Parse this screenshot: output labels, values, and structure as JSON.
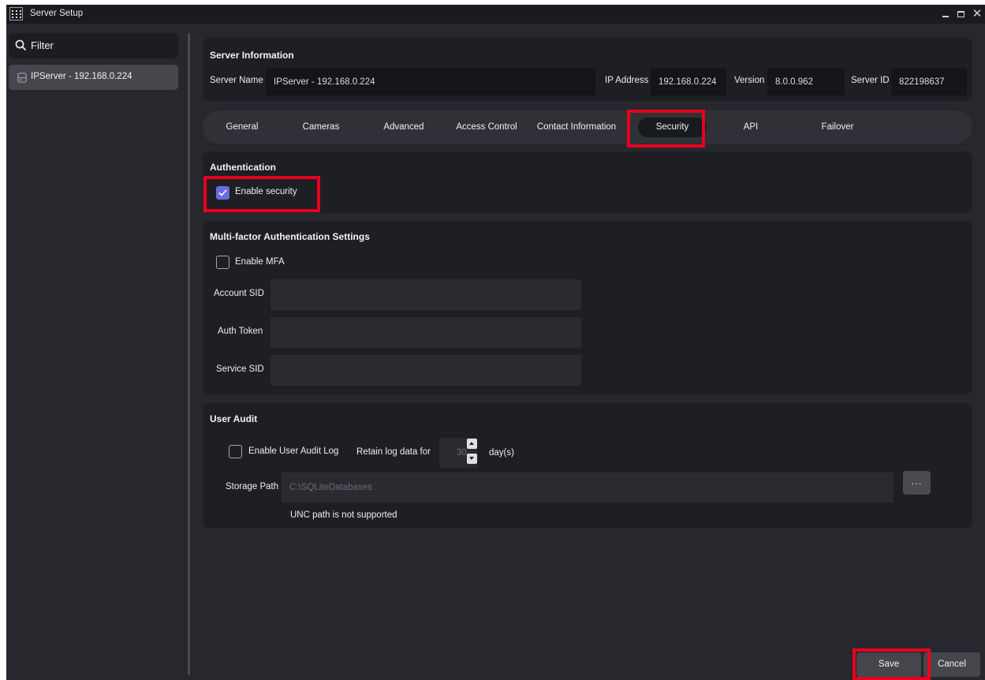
{
  "window": {
    "title": "Server Setup"
  },
  "sidebar": {
    "filter_label": "Filter",
    "items": [
      {
        "label": "IPServer - 192.168.0.224"
      }
    ]
  },
  "server_info": {
    "title": "Server Information",
    "name_label": "Server Name",
    "name_value": "IPServer - 192.168.0.224",
    "ip_label": "IP Address",
    "ip_value": "192.168.0.224",
    "version_label": "Version",
    "version_value": "8.0.0.962",
    "server_id_label": "Server ID",
    "server_id_value": "822198637"
  },
  "tabs": [
    {
      "label": "General"
    },
    {
      "label": "Cameras"
    },
    {
      "label": "Advanced"
    },
    {
      "label": "Access Control"
    },
    {
      "label": "Contact Information"
    },
    {
      "label": "Security",
      "active": true
    },
    {
      "label": "API"
    },
    {
      "label": "Failover"
    }
  ],
  "authentication": {
    "title": "Authentication",
    "enable_security_label": "Enable security",
    "enable_security_checked": true
  },
  "mfa": {
    "title": "Multi-factor Authentication Settings",
    "enable_mfa_label": "Enable MFA",
    "enable_mfa_checked": false,
    "account_sid_label": "Account SID",
    "account_sid_value": "",
    "auth_token_label": "Auth Token",
    "auth_token_value": "",
    "service_sid_label": "Service SID",
    "service_sid_value": ""
  },
  "user_audit": {
    "title": "User Audit",
    "enable_log_label": "Enable User Audit Log",
    "enable_log_checked": false,
    "retain_label": "Retain log data for",
    "retain_value": "30",
    "retain_unit": "day(s)",
    "storage_path_label": "Storage Path",
    "storage_path_value": "C:\\SQLiteDatabases",
    "browse_label": "...",
    "unc_note": "UNC path is not supported"
  },
  "footer": {
    "save_label": "Save",
    "cancel_label": "Cancel"
  },
  "colors": {
    "accent": "#6b6be0",
    "highlight": "#e8001e",
    "background": "#27282d",
    "panel": "#1e1f23"
  }
}
